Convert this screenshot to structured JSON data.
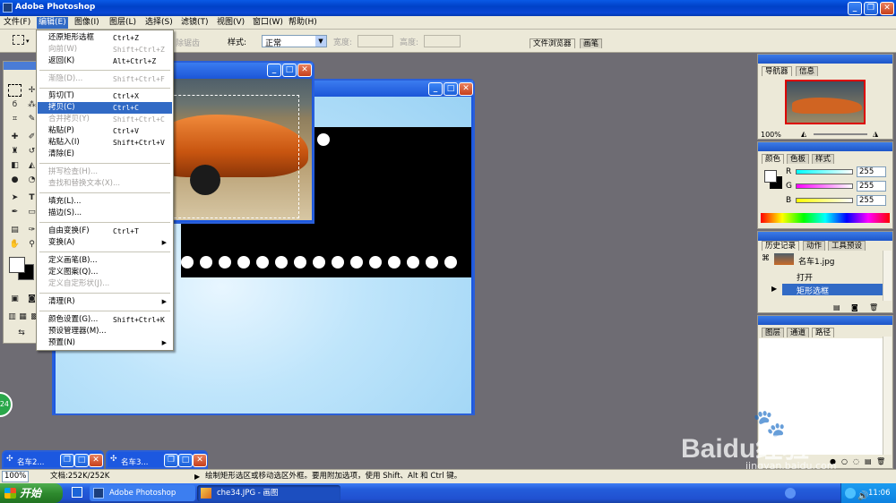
{
  "app": {
    "title": "Adobe Photoshop"
  },
  "menubar": [
    "文件(F)",
    "编辑(E)",
    "图像(I)",
    "图层(L)",
    "选择(S)",
    "滤镜(T)",
    "视图(V)",
    "窗口(W)",
    "帮助(H)"
  ],
  "options": {
    "feather_label": "除锯齿",
    "style_label": "样式:",
    "style_value": "正常",
    "width_label": "宽度:",
    "height_label": "高度:",
    "tab_file_browser": "文件浏览器",
    "tab_brushes": "画笔"
  },
  "edit_menu": [
    {
      "label": "还原矩形选框",
      "shortcut": "Ctrl+Z",
      "state": "normal"
    },
    {
      "label": "向前(W)",
      "shortcut": "Shift+Ctrl+Z",
      "state": "disabled"
    },
    {
      "label": "返回(K)",
      "shortcut": "Alt+Ctrl+Z",
      "state": "normal"
    },
    {
      "label": "渐隐(D)...",
      "shortcut": "Shift+Ctrl+F",
      "state": "disabled"
    },
    {
      "label": "剪切(T)",
      "shortcut": "Ctrl+X",
      "state": "normal"
    },
    {
      "label": "拷贝(C)",
      "shortcut": "Ctrl+C",
      "state": "highlighted"
    },
    {
      "label": "合并拷贝(Y)",
      "shortcut": "Shift+Ctrl+C",
      "state": "disabled"
    },
    {
      "label": "粘贴(P)",
      "shortcut": "Ctrl+V",
      "state": "normal"
    },
    {
      "label": "粘贴入(I)",
      "shortcut": "Shift+Ctrl+V",
      "state": "normal"
    },
    {
      "label": "清除(E)",
      "shortcut": "",
      "state": "normal"
    },
    {
      "label": "拼写检查(H)...",
      "shortcut": "",
      "state": "disabled"
    },
    {
      "label": "查找和替换文本(X)...",
      "shortcut": "",
      "state": "disabled"
    },
    {
      "label": "填充(L)...",
      "shortcut": "",
      "state": "normal"
    },
    {
      "label": "描边(S)...",
      "shortcut": "",
      "state": "normal"
    },
    {
      "label": "自由变换(F)",
      "shortcut": "Ctrl+T",
      "state": "normal"
    },
    {
      "label": "变换(A)",
      "shortcut": "",
      "state": "submenu"
    },
    {
      "label": "定义画笔(B)...",
      "shortcut": "",
      "state": "normal"
    },
    {
      "label": "定义图案(Q)...",
      "shortcut": "",
      "state": "normal"
    },
    {
      "label": "定义自定形状(J)...",
      "shortcut": "",
      "state": "disabled"
    },
    {
      "label": "清理(R)",
      "shortcut": "",
      "state": "submenu"
    },
    {
      "label": "颜色设置(G)...",
      "shortcut": "Shift+Ctrl+K",
      "state": "normal"
    },
    {
      "label": "预设管理器(M)...",
      "shortcut": "",
      "state": "normal"
    },
    {
      "label": "预置(N)",
      "shortcut": "",
      "state": "submenu"
    }
  ],
  "navigator": {
    "tabs": [
      "导航器",
      "信息"
    ],
    "zoom": "100%"
  },
  "color": {
    "tabs": [
      "颜色",
      "色板",
      "样式"
    ],
    "r_label": "R",
    "g_label": "G",
    "b_label": "B",
    "r": "255",
    "g": "255",
    "b": "255"
  },
  "history": {
    "tabs": [
      "历史记录",
      "动作",
      "工具预设"
    ],
    "snapshot": "名车1.jpg",
    "items": [
      "打开",
      "矩形选框"
    ]
  },
  "layers": {
    "tabs": [
      "图层",
      "通道",
      "路径"
    ]
  },
  "minimized_docs": [
    "名车2...",
    "名车3..."
  ],
  "status": {
    "zoom": "100%",
    "doc": "文档:252K/252K",
    "hint": "绘制矩形选区或移动选区外框。要用附加选项，使用 Shift、Alt 和 Ctrl 键。"
  },
  "taskbar": {
    "start": "开始",
    "tasks": [
      "Adobe Photoshop",
      "che34.JPG - 画图"
    ],
    "clock": "11:06"
  },
  "watermark": {
    "brand": "Baidu经验",
    "url": "jingyan.baidu.com"
  },
  "badge": "24",
  "colors": {
    "menu_highlight": "#316ac5",
    "xp_blue": "#0a5ae6",
    "workspace": "#6e6c73"
  }
}
